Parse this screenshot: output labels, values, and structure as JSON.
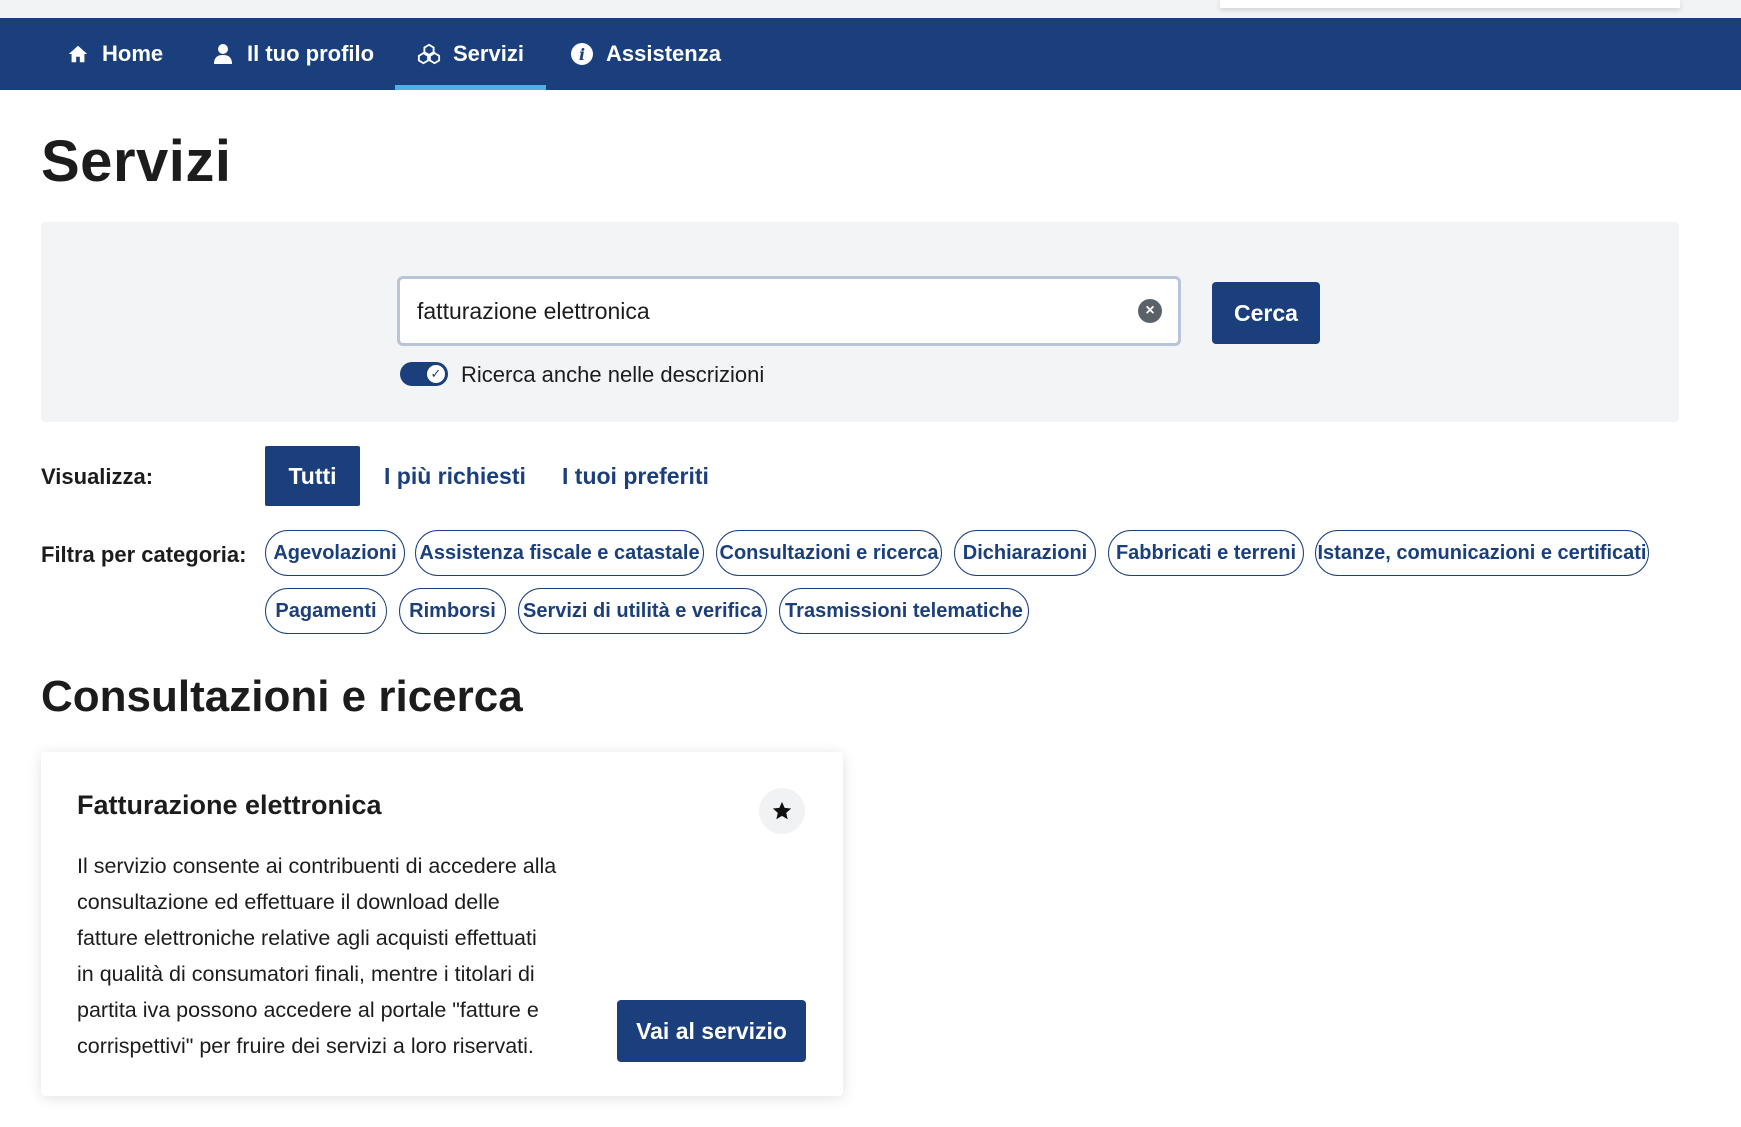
{
  "nav": {
    "items": [
      {
        "label": "Home",
        "icon": "home-icon"
      },
      {
        "label": "Il tuo profilo",
        "icon": "user-icon"
      },
      {
        "label": "Servizi",
        "icon": "services-icon",
        "active": true
      },
      {
        "label": "Assistenza",
        "icon": "info-icon"
      }
    ]
  },
  "page": {
    "title": "Servizi"
  },
  "search": {
    "value": "fatturazione elettronica",
    "button_label": "Cerca",
    "toggle_label": "Ricerca anche nelle descrizioni",
    "toggle_on": true
  },
  "view": {
    "label": "Visualizza:",
    "tabs": [
      {
        "label": "Tutti",
        "active": true
      },
      {
        "label": "I più richiesti"
      },
      {
        "label": "I tuoi preferiti"
      }
    ]
  },
  "filter": {
    "label": "Filtra per categoria:",
    "categories": [
      "Agevolazioni",
      "Assistenza fiscale e catastale",
      "Consultazioni e ricerca",
      "Dichiarazioni",
      "Fabbricati e terreni",
      "Istanze, comunicazioni e certificati",
      "Pagamenti",
      "Rimborsi",
      "Servizi di utilità e verifica",
      "Trasmissioni telematiche"
    ]
  },
  "section": {
    "title": "Consultazioni e ricerca"
  },
  "card": {
    "title": "Fatturazione elettronica",
    "description_lines": [
      "Il servizio consente ai contribuenti di accedere alla",
      "consultazione ed effettuare il download delle",
      "fatture elettroniche relative agli acquisti effettuati",
      "in qualità di consumatori finali, mentre i titolari di",
      "partita iva possono accedere al portale \"fatture e",
      "corrispettivi\" per fruire dei servizi a loro riservati."
    ],
    "button_label": "Vai al servizio",
    "favorite_icon": "star-icon"
  },
  "colors": {
    "primary": "#1a3f7c",
    "accent": "#4fb0e8",
    "panel_bg": "#f3f4f6"
  }
}
